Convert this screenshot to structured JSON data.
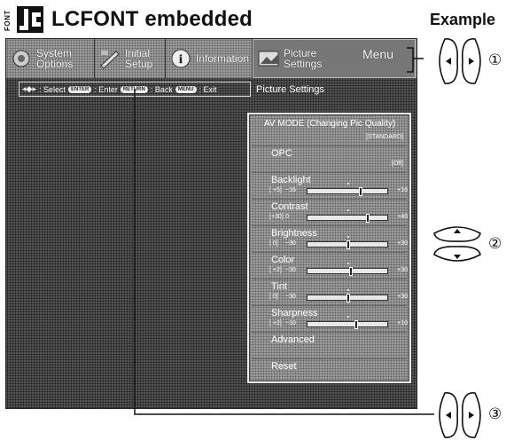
{
  "header": {
    "font_label": "FONT",
    "title": "LCFONT embedded",
    "example_label": "Example"
  },
  "menu": {
    "tabs": [
      {
        "label": "System\nOptions",
        "icon": "system-options-icon",
        "active": false
      },
      {
        "label": "Initial\nSetup",
        "icon": "initial-setup-icon",
        "active": false
      },
      {
        "label": "Information",
        "icon": "information-icon",
        "active": false
      },
      {
        "label": "Picture\nSettings",
        "icon": "picture-settings-icon",
        "active": true
      }
    ],
    "menu_label": "Menu"
  },
  "help_bar": {
    "select": ": Select",
    "enter_key": "ENTER",
    "enter": ": Enter",
    "return_key": "RETURN",
    "back": ": Back",
    "menu_key": "MENU",
    "exit": ": Exit"
  },
  "page_heading": "Picture Settings",
  "settings": {
    "av_mode": {
      "label": "AV MODE (Changing Pic Quality)",
      "value": "[STANDARD]"
    },
    "opc": {
      "label": "OPC",
      "value": "[Off]"
    },
    "backlight": {
      "label": "Backlight",
      "current": "[ +5]",
      "min": "−16",
      "max": "+16",
      "level": 0.66
    },
    "contrast": {
      "label": "Contrast",
      "current": "[+30]",
      "min": "0",
      "max": "+40",
      "level": 0.75
    },
    "brightness": {
      "label": "Brightness",
      "current": "[  0]",
      "min": "−30",
      "max": "+30",
      "level": 0.5
    },
    "color": {
      "label": "Color",
      "current": "[ +2]",
      "min": "−30",
      "max": "+30",
      "level": 0.53
    },
    "tint": {
      "label": "Tint",
      "current": "[  0]",
      "min": "−30",
      "max": "+30",
      "level": 0.5
    },
    "sharpness": {
      "label": "Sharpness",
      "current": "[ +2]",
      "min": "−10",
      "max": "+10",
      "level": 0.6
    },
    "advanced": {
      "label": "Advanced"
    },
    "reset": {
      "label": "Reset"
    }
  },
  "controls": {
    "num1": "①",
    "num2": "②",
    "num3": "③"
  }
}
